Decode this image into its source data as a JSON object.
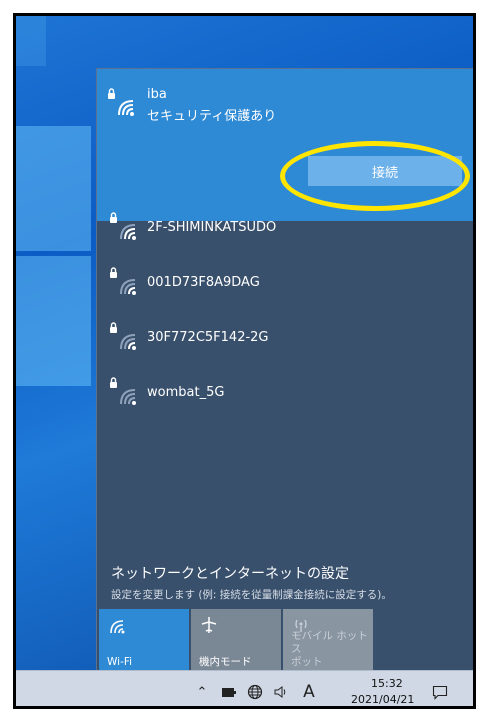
{
  "flyout": {
    "connected_network": {
      "name": "iba",
      "status": "セキュリティ保護あり",
      "connect_label": "接続"
    },
    "networks": [
      {
        "name": "2F-SHIMINKATSUDO"
      },
      {
        "name": "001D73F8A9DAG"
      },
      {
        "name": "30F772C5F142-2G"
      },
      {
        "name": "wombat_5G"
      }
    ],
    "settings": {
      "title": "ネットワークとインターネットの設定",
      "description": "設定を変更します (例: 接続を従量制課金接続に設定する)。"
    },
    "quick_actions": [
      {
        "label": "Wi-Fi",
        "icon": "wifi-icon",
        "active": true
      },
      {
        "label": "機内モード",
        "icon": "airplane-icon",
        "active": false
      },
      {
        "label": "モバイル ホットス\nポット",
        "icon": "hotspot-icon",
        "active": false,
        "disabled": true
      }
    ]
  },
  "taskbar": {
    "ime_label": "A",
    "time": "15:32",
    "date": "2021/04/21"
  },
  "colors": {
    "accent": "#2f8ad6",
    "flyout_bg": "#39506c",
    "button": "#6db1ea",
    "highlight_circle": "#ffe500",
    "taskbar": "#cfd8e4"
  }
}
